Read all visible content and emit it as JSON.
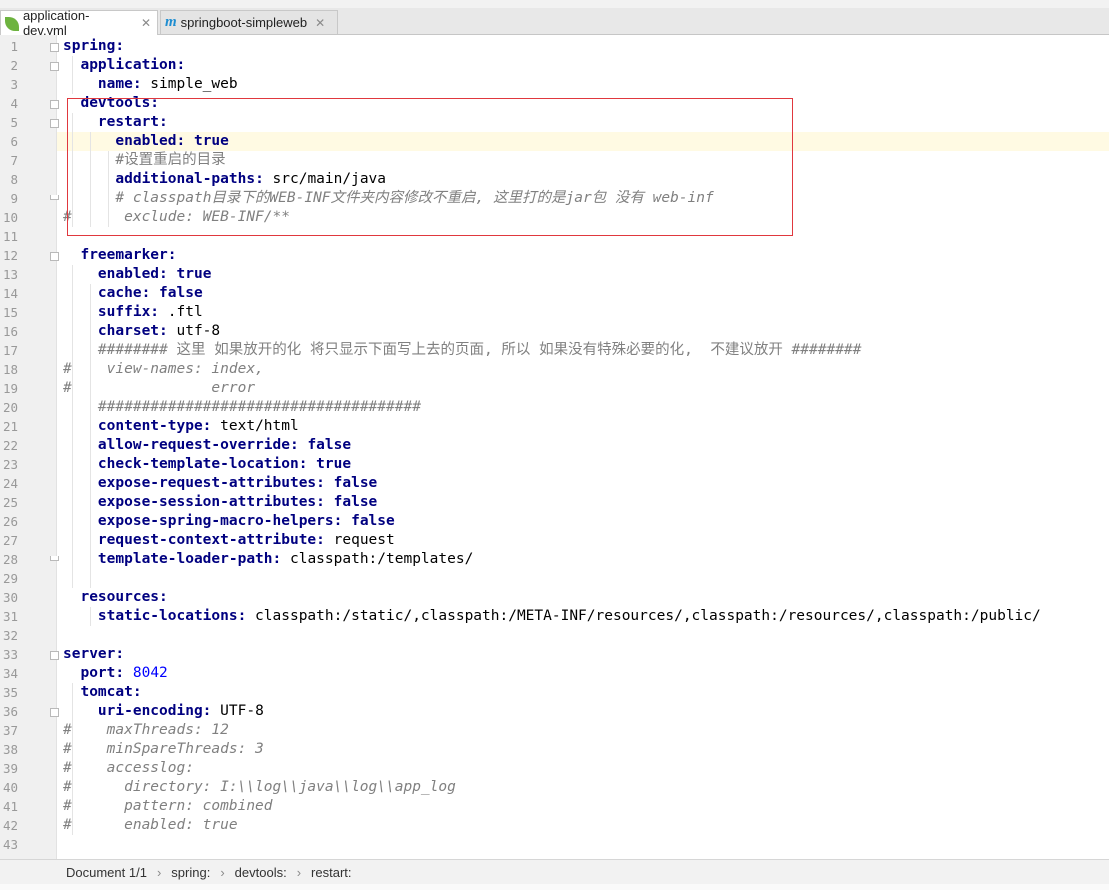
{
  "tabs": [
    {
      "label": "application-dev.yml",
      "icon": "spring-leaf-icon",
      "active": true
    },
    {
      "label": "springboot-simpleweb",
      "icon": "maven-icon",
      "active": false
    }
  ],
  "editor": {
    "current_line": 6,
    "lines": [
      {
        "n": "1",
        "parts": [
          [
            "key",
            "spring:"
          ]
        ]
      },
      {
        "n": "2",
        "parts": [
          [
            "plain",
            "  "
          ],
          [
            "key",
            "application:"
          ]
        ]
      },
      {
        "n": "3",
        "parts": [
          [
            "plain",
            "    "
          ],
          [
            "key",
            "name:"
          ],
          [
            "plain",
            " simple_web"
          ]
        ]
      },
      {
        "n": "4",
        "parts": [
          [
            "plain",
            "  "
          ],
          [
            "key",
            "devtools:"
          ]
        ]
      },
      {
        "n": "5",
        "parts": [
          [
            "plain",
            "    "
          ],
          [
            "key",
            "restart:"
          ]
        ]
      },
      {
        "n": "6",
        "parts": [
          [
            "plain",
            "      "
          ],
          [
            "key",
            "enabled:"
          ],
          [
            "plain",
            " "
          ],
          [
            "bool",
            "true"
          ]
        ]
      },
      {
        "n": "7",
        "parts": [
          [
            "plain",
            "      "
          ],
          [
            "cmtp",
            "#设置重启的目录"
          ]
        ]
      },
      {
        "n": "8",
        "parts": [
          [
            "plain",
            "      "
          ],
          [
            "key",
            "additional-paths:"
          ],
          [
            "plain",
            " src/main/java"
          ]
        ]
      },
      {
        "n": "9",
        "parts": [
          [
            "plain",
            "      "
          ],
          [
            "cmt",
            "# classpath目录下的WEB-INF文件夹内容修改不重启, 这里打的是jar包 没有 web-inf"
          ]
        ]
      },
      {
        "n": "10",
        "parts": [
          [
            "cmt",
            "#      exclude: WEB-INF/**"
          ]
        ]
      },
      {
        "n": "11",
        "parts": []
      },
      {
        "n": "12",
        "parts": [
          [
            "plain",
            "  "
          ],
          [
            "key",
            "freemarker:"
          ]
        ]
      },
      {
        "n": "13",
        "parts": [
          [
            "plain",
            "    "
          ],
          [
            "key",
            "enabled:"
          ],
          [
            "plain",
            " "
          ],
          [
            "bool",
            "true"
          ]
        ]
      },
      {
        "n": "14",
        "parts": [
          [
            "plain",
            "    "
          ],
          [
            "key",
            "cache:"
          ],
          [
            "plain",
            " "
          ],
          [
            "bool",
            "false"
          ]
        ]
      },
      {
        "n": "15",
        "parts": [
          [
            "plain",
            "    "
          ],
          [
            "key",
            "suffix:"
          ],
          [
            "plain",
            " .ftl"
          ]
        ]
      },
      {
        "n": "16",
        "parts": [
          [
            "plain",
            "    "
          ],
          [
            "key",
            "charset:"
          ],
          [
            "plain",
            " utf-8"
          ]
        ]
      },
      {
        "n": "17",
        "parts": [
          [
            "plain",
            "    "
          ],
          [
            "cmtp",
            "######## 这里 如果放开的化 将只显示下面写上去的页面, 所以 如果没有特殊必要的化,  不建议放开 ########"
          ]
        ]
      },
      {
        "n": "18",
        "parts": [
          [
            "cmt",
            "#    view-names: index,"
          ]
        ]
      },
      {
        "n": "19",
        "parts": [
          [
            "cmt",
            "#                error"
          ]
        ]
      },
      {
        "n": "20",
        "parts": [
          [
            "plain",
            "    "
          ],
          [
            "cmtp",
            "#####################################"
          ]
        ]
      },
      {
        "n": "21",
        "parts": [
          [
            "plain",
            "    "
          ],
          [
            "key",
            "content-type:"
          ],
          [
            "plain",
            " text/html"
          ]
        ]
      },
      {
        "n": "22",
        "parts": [
          [
            "plain",
            "    "
          ],
          [
            "key",
            "allow-request-override:"
          ],
          [
            "plain",
            " "
          ],
          [
            "bool",
            "false"
          ]
        ]
      },
      {
        "n": "23",
        "parts": [
          [
            "plain",
            "    "
          ],
          [
            "key",
            "check-template-location:"
          ],
          [
            "plain",
            " "
          ],
          [
            "bool",
            "true"
          ]
        ]
      },
      {
        "n": "24",
        "parts": [
          [
            "plain",
            "    "
          ],
          [
            "key",
            "expose-request-attributes:"
          ],
          [
            "plain",
            " "
          ],
          [
            "bool",
            "false"
          ]
        ]
      },
      {
        "n": "25",
        "parts": [
          [
            "plain",
            "    "
          ],
          [
            "key",
            "expose-session-attributes:"
          ],
          [
            "plain",
            " "
          ],
          [
            "bool",
            "false"
          ]
        ]
      },
      {
        "n": "26",
        "parts": [
          [
            "plain",
            "    "
          ],
          [
            "key",
            "expose-spring-macro-helpers:"
          ],
          [
            "plain",
            " "
          ],
          [
            "bool",
            "false"
          ]
        ]
      },
      {
        "n": "27",
        "parts": [
          [
            "plain",
            "    "
          ],
          [
            "key",
            "request-context-attribute:"
          ],
          [
            "plain",
            " request"
          ]
        ]
      },
      {
        "n": "28",
        "parts": [
          [
            "plain",
            "    "
          ],
          [
            "key",
            "template-loader-path:"
          ],
          [
            "plain",
            " classpath:/templates/"
          ]
        ]
      },
      {
        "n": "29",
        "parts": []
      },
      {
        "n": "30",
        "parts": [
          [
            "plain",
            "  "
          ],
          [
            "key",
            "resources:"
          ]
        ]
      },
      {
        "n": "31",
        "parts": [
          [
            "plain",
            "    "
          ],
          [
            "key",
            "static-locations:"
          ],
          [
            "plain",
            " classpath:/static/,classpath:/META-INF/resources/,classpath:/resources/,classpath:/public/"
          ]
        ]
      },
      {
        "n": "32",
        "parts": []
      },
      {
        "n": "33",
        "parts": [
          [
            "key",
            "server:"
          ]
        ]
      },
      {
        "n": "34",
        "parts": [
          [
            "plain",
            "  "
          ],
          [
            "key",
            "port:"
          ],
          [
            "plain",
            " "
          ],
          [
            "num",
            "8042"
          ]
        ]
      },
      {
        "n": "35",
        "parts": [
          [
            "plain",
            "  "
          ],
          [
            "key",
            "tomcat:"
          ]
        ]
      },
      {
        "n": "36",
        "parts": [
          [
            "plain",
            "    "
          ],
          [
            "key",
            "uri-encoding:"
          ],
          [
            "plain",
            " UTF-8"
          ]
        ]
      },
      {
        "n": "37",
        "parts": [
          [
            "cmt",
            "#    maxThreads: 12"
          ]
        ]
      },
      {
        "n": "38",
        "parts": [
          [
            "cmt",
            "#    minSpareThreads: 3"
          ]
        ]
      },
      {
        "n": "39",
        "parts": [
          [
            "cmt",
            "#    accesslog:"
          ]
        ]
      },
      {
        "n": "40",
        "parts": [
          [
            "cmt",
            "#      directory: I:\\\\log\\\\java\\\\log\\\\app_log"
          ]
        ]
      },
      {
        "n": "41",
        "parts": [
          [
            "cmt",
            "#      pattern: combined"
          ]
        ]
      },
      {
        "n": "42",
        "parts": [
          [
            "cmt",
            "#      enabled: true"
          ]
        ]
      },
      {
        "n": "43",
        "parts": []
      }
    ]
  },
  "statusbar": {
    "document": "Document 1/1",
    "breadcrumb": [
      "spring:",
      "devtools:",
      "restart:"
    ]
  },
  "colors": {
    "key": "#000080",
    "comment": "#808080",
    "number": "#0000ff",
    "highlight_box": "#e0383e",
    "current_line": "#fffae3"
  }
}
